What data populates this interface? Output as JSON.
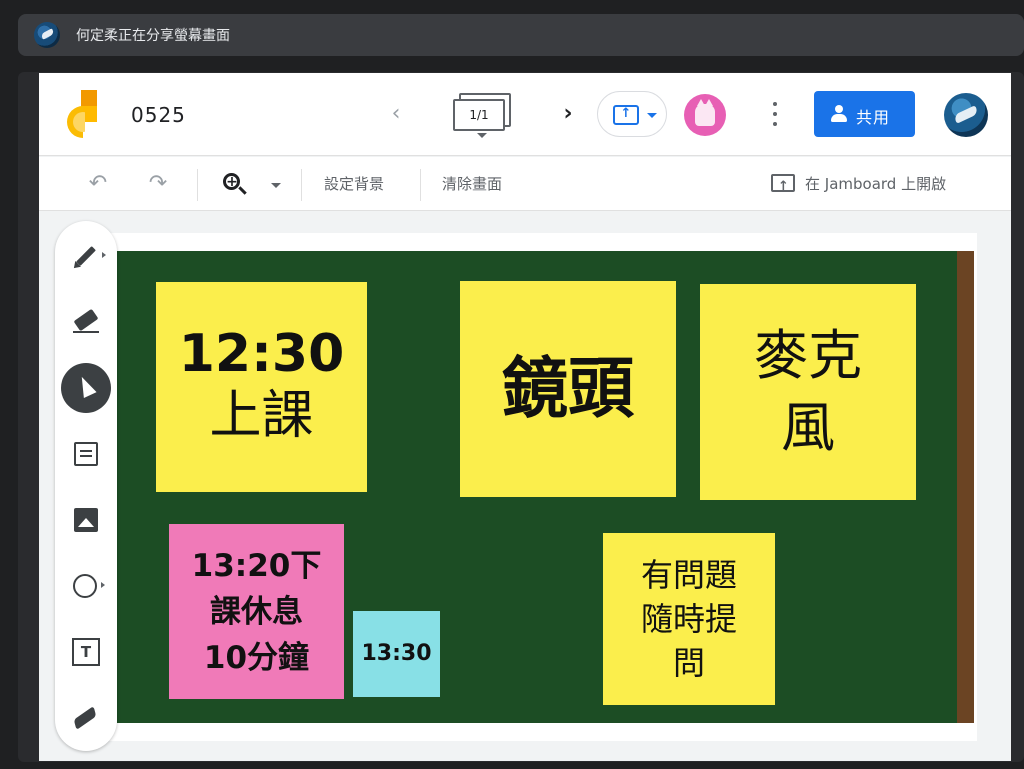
{
  "share_banner": {
    "text": "何定柔正在分享螢幕畫面",
    "icon": "presenter-avatar-icon"
  },
  "header": {
    "doc_title": "0525",
    "frame_counter": "1/1",
    "share_label": "共用",
    "icons": [
      "jamboard-logo-icon",
      "chevron-left-icon",
      "chevron-right-icon",
      "present-screen-icon",
      "more-vert-icon",
      "person-share-icon"
    ]
  },
  "toolbar": {
    "set_background": "設定背景",
    "clear_frame": "清除畫面",
    "open_in_jamboard": "在 Jamboard 上開啟",
    "icons": [
      "undo-icon",
      "redo-icon",
      "zoom-in-icon",
      "open-external-icon"
    ]
  },
  "tools": [
    {
      "name": "pen-icon"
    },
    {
      "name": "eraser-icon"
    },
    {
      "name": "select-cursor-icon",
      "active": true
    },
    {
      "name": "sticky-note-icon"
    },
    {
      "name": "image-icon"
    },
    {
      "name": "circle-shape-icon"
    },
    {
      "name": "text-box-icon"
    },
    {
      "name": "laser-icon"
    }
  ],
  "notes": {
    "time": {
      "line1": "12:30",
      "line2": "上課",
      "color": "#fbee4c"
    },
    "camera": {
      "line1": "鏡頭",
      "color": "#fbee4c"
    },
    "mic": {
      "line1": "麥克",
      "line2": "風",
      "color": "#fbee4c"
    },
    "break": {
      "line1": "13:20下",
      "line2": "課休息",
      "line3": "10分鐘",
      "color": "#f07ab8"
    },
    "back": {
      "line1": "13:30",
      "color": "#88e0e6"
    },
    "questions": {
      "line1": "有問題",
      "line2": "隨時提",
      "line3": "問",
      "color": "#fbee4c"
    }
  },
  "colors": {
    "board": "#1c4d24",
    "accent": "#1a73e8"
  }
}
